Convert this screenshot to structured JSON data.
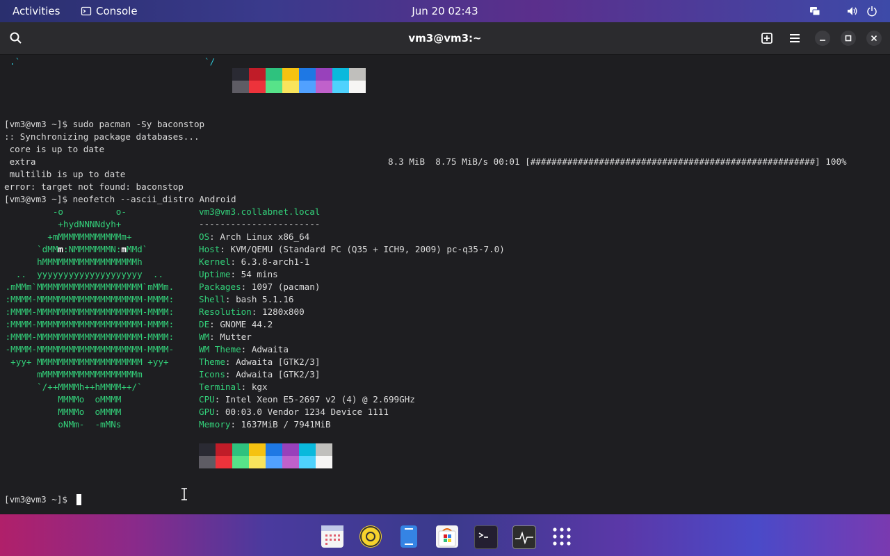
{
  "topbar": {
    "activities": "Activities",
    "app_name": "Console",
    "datetime": "Jun 20  02:43"
  },
  "window": {
    "title": "vm3@vm3:~"
  },
  "terminal": {
    "top_frag_left": ".`",
    "top_frag_right": "`/",
    "history": [
      "[vm3@vm3 ~]$ sudo pacman -Sy baconstop",
      ":: Synchronizing package databases...",
      " core is up to date",
      " extra",
      " multilib is up to date",
      "error: target not found: baconstop",
      "[vm3@vm3 ~]$ neofetch --ascii_distro Android"
    ],
    "extra_progress": "8.3 MiB  8.75 MiB/s 00:01 [######################################################] 100%",
    "ascii": [
      "          -o          o-",
      "           +hydNNNNdyh+",
      "         +mMMMMMMMMMMMMm+",
      "       `dMM",
      "       hMMMMMMMMMMMMMMMMMMh",
      "   ..  yyyyyyyyyyyyyyyyyyyy  ..",
      " .mMMm`MMMMMMMMMMMMMMMMMMMM`mMMm.",
      " :MMMM-MMMMMMMMMMMMMMMMMMMM-MMMM:",
      " :MMMM-MMMMMMMMMMMMMMMMMMMM-MMMM:",
      " :MMMM-MMMMMMMMMMMMMMMMMMMM-MMMM:",
      " :MMMM-MMMMMMMMMMMMMMMMMMMM-MMMM:",
      " -MMMM-MMMMMMMMMMMMMMMMMMMM-MMMM-",
      "  +yy+ MMMMMMMMMMMMMMMMMMMM +yy+",
      "       mMMMMMMMMMMMMMMMMMMm",
      "       `/++MMMMh++hMMMM++/`",
      "           MMMMo  oMMMM",
      "           MMMMo  oMMMM",
      "           oNMm-  -mMNs"
    ],
    "ascii_eyes": {
      "a": "m",
      "b": ":NMMMMMMMN:",
      "c": "m",
      "d": "MMd`"
    },
    "userhost": "vm3@vm3.collabnet.local",
    "separator": "-----------------------",
    "info": [
      {
        "k": "OS",
        "v": ": Arch Linux x86_64"
      },
      {
        "k": "Host",
        "v": ": KVM/QEMU (Standard PC (Q35 + ICH9, 2009) pc-q35-7.0)"
      },
      {
        "k": "Kernel",
        "v": ": 6.3.8-arch1-1"
      },
      {
        "k": "Uptime",
        "v": ": 54 mins"
      },
      {
        "k": "Packages",
        "v": ": 1097 (pacman)"
      },
      {
        "k": "Shell",
        "v": ": bash 5.1.16"
      },
      {
        "k": "Resolution",
        "v": ": 1280x800"
      },
      {
        "k": "DE",
        "v": ": GNOME 44.2"
      },
      {
        "k": "WM",
        "v": ": Mutter"
      },
      {
        "k": "WM Theme",
        "v": ": Adwaita"
      },
      {
        "k": "Theme",
        "v": ": Adwaita [GTK2/3]"
      },
      {
        "k": "Icons",
        "v": ": Adwaita [GTK2/3]"
      },
      {
        "k": "Terminal",
        "v": ": kgx"
      },
      {
        "k": "CPU",
        "v": ": Intel Xeon E5-2697 v2 (4) @ 2.699GHz"
      },
      {
        "k": "GPU",
        "v": ": 00:03.0 Vendor 1234 Device 1111"
      },
      {
        "k": "Memory",
        "v": ": 1637MiB / 7941MiB"
      }
    ],
    "prompt": "[vm3@vm3 ~]$ ",
    "palette_dark": [
      "#2a2a33",
      "#c01c28",
      "#2ec27e",
      "#f5c211",
      "#1e78e4",
      "#9841bb",
      "#0ab9dc",
      "#c0bfbc"
    ],
    "palette_light": [
      "#5e5c64",
      "#ed333b",
      "#57e389",
      "#f8e45c",
      "#51a1ff",
      "#c061cb",
      "#4fd2fd",
      "#f6f5f4"
    ]
  },
  "dock": {
    "apps": [
      "calendar-icon",
      "rhythmbox-icon",
      "text-editor-icon",
      "software-icon",
      "terminal-icon",
      "system-monitor-icon",
      "app-grid-icon"
    ]
  }
}
